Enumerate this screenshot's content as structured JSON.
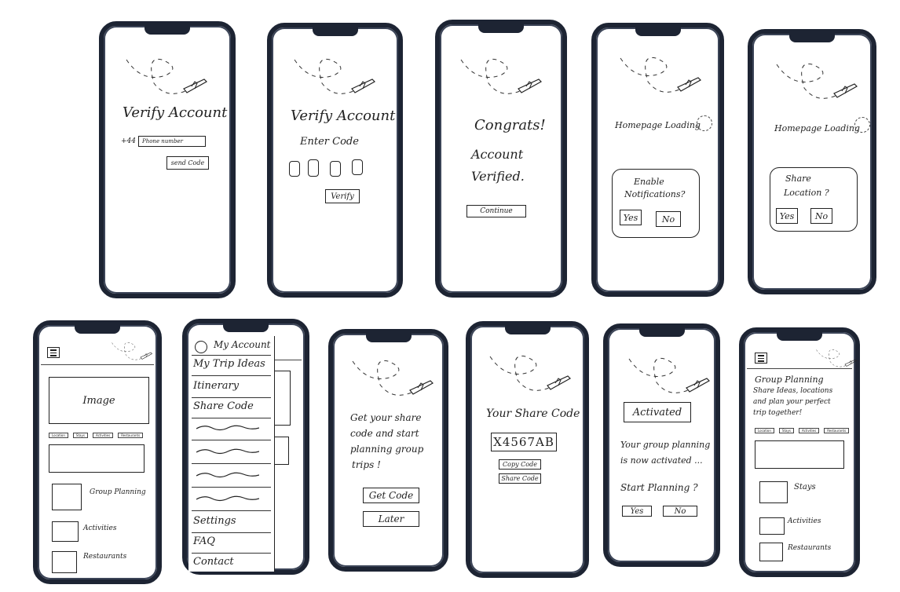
{
  "screens": {
    "s1": {
      "title": "Verify Account",
      "country_code": "+44",
      "phone_placeholder": "Phone number",
      "send_button": "send Code"
    },
    "s2": {
      "title": "Verify Account",
      "subtitle": "Enter Code",
      "verify_button": "Verify"
    },
    "s3": {
      "line1": "Congrats!",
      "line2": "Account",
      "line3": "Verified.",
      "continue_button": "Continue"
    },
    "s4": {
      "header": "Homepage Loading",
      "prompt_line1": "Enable",
      "prompt_line2": "Notifications?",
      "yes": "Yes",
      "no": "No"
    },
    "s5": {
      "header": "Homepage Loading",
      "prompt_line1": "Share",
      "prompt_line2": "Location ?",
      "yes": "Yes",
      "no": "No"
    },
    "s6": {
      "image_label": "Image",
      "tabs": [
        "Location",
        "Stays",
        "Activities",
        "Restaurants"
      ],
      "items": [
        "Group Planning",
        "Activities",
        "Restaurants"
      ]
    },
    "s7": {
      "menu": [
        "My Account",
        "My Trip Ideas",
        "Itinerary",
        "Share Code",
        "Settings",
        "FAQ",
        "Contact"
      ]
    },
    "s8": {
      "line1": "Get your share",
      "line2": "code and start",
      "line3": "planning group",
      "line4": "trips !",
      "get_code": "Get Code",
      "later": "Later"
    },
    "s9": {
      "title": "Your Share Code",
      "code": "X4567AB",
      "copy_button": "Copy Code",
      "share_button": "Share Code"
    },
    "s10": {
      "badge": "Activated",
      "line1": "Your group planning",
      "line2": "is now activated ...",
      "question": "Start Planning ?",
      "yes": "Yes",
      "no": "No"
    },
    "s11": {
      "title": "Group Planning",
      "line1": "Share Ideas, locations",
      "line2": "and plan your perfect",
      "line3": "trip together!",
      "tabs": [
        "Location",
        "Stays",
        "Activities",
        "Restaurants"
      ],
      "items": [
        "Stays",
        "Activities",
        "Restaurants"
      ]
    }
  }
}
